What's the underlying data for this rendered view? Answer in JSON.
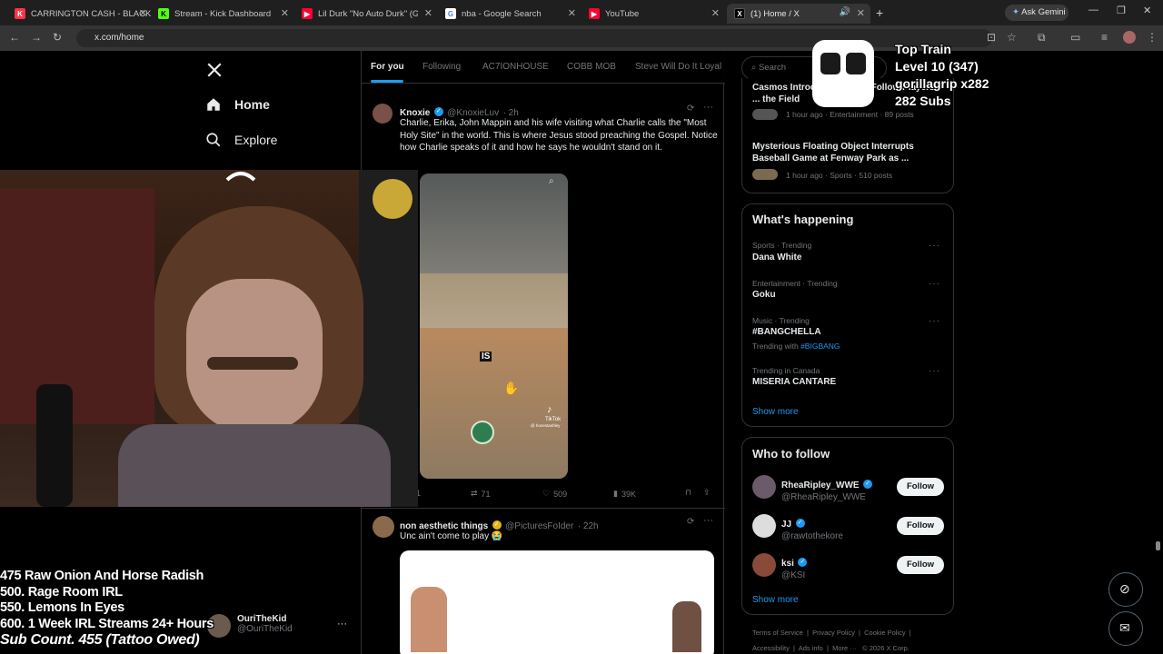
{
  "browser": {
    "tabs": [
      {
        "label": "CARRINGTON CASH - BLACK B",
        "icon": "kick-favicon",
        "color": "#ff3344"
      },
      {
        "label": "Stream - Kick Dashboard",
        "icon": "kick-favicon",
        "color": "#53fc18"
      },
      {
        "label": "Lil Durk \"No Auto Durk\" (G Her",
        "icon": "youtube-favicon",
        "color": "#ff0033"
      },
      {
        "label": "nba - Google Search",
        "icon": "google-favicon",
        "color": "#4285f4"
      },
      {
        "label": "YouTube",
        "icon": "youtube-favicon",
        "color": "#ff0033"
      },
      {
        "label": "(1) Home / X",
        "icon": "x-favicon",
        "color": "#000000"
      }
    ],
    "ask_gemini": "Ask Gemini",
    "url": "x.com/home"
  },
  "nav": {
    "home": "Home",
    "explore": "Explore"
  },
  "feed": {
    "tabs": [
      "For you",
      "Following",
      "AC7IONHOUSE",
      "COBB MOB",
      "Steve Will Do It Loyal"
    ],
    "search_placeholder": "Search",
    "post1": {
      "name": "Knoxie",
      "handle": "@KnoxieLuv",
      "time": "· 2h",
      "text": "Charlie, Erika, John Mappin and his wife visiting what Charlie calls the \"Most Holy Site\" in the world. This is where Jesus stood preaching the Gospel. Notice how Charlie speaks of it and how he says he wouldn't stand on it.",
      "video_caption": "IS",
      "tiktok": "TikTok",
      "tiktok_handle": "@ honestashley",
      "reposts": "71",
      "likes": "509",
      "views": "39K",
      "replies": "1"
    },
    "post2": {
      "name": "non aesthetic things",
      "handle": "@PicturesFoIder",
      "time": "· 22h",
      "text": "Unc ain't come to play 😭"
    },
    "suggest": {
      "name": "OuriTheKid",
      "handle": "@OuriTheKid"
    }
  },
  "right": {
    "trends_top": [
      {
        "title": "Casmos Introduces ... That Follow Players ... the Field",
        "meta": "1 hour ago · Entertainment · 89 posts"
      },
      {
        "title": "Mysterious Floating Object Interrupts Baseball Game at Fenway Park as ...",
        "meta": "1 hour ago · Sports · 510 posts"
      }
    ],
    "happening_title": "What's happening",
    "trends": [
      {
        "meta": "Sports · Trending",
        "title": "Dana White",
        "extra": ""
      },
      {
        "meta": "Entertainment · Trending",
        "title": "Goku",
        "extra": ""
      },
      {
        "meta": "Music · Trending",
        "title": "#BANGCHELLA",
        "extra_pre": "Trending with ",
        "extra": "#BIGBANG"
      },
      {
        "meta": "Trending in Canada",
        "title": "MISERIA CANTARE",
        "extra": ""
      }
    ],
    "show_more": "Show more",
    "follow_title": "Who to follow",
    "follow": [
      {
        "name": "RheaRipley_WWE",
        "handle": "@RheaRipley_WWE",
        "btn": "Follow"
      },
      {
        "name": "JJ",
        "handle": "@rawtothekore",
        "btn": "Follow"
      },
      {
        "name": "ksi",
        "handle": "@KSI",
        "btn": "Follow"
      }
    ],
    "show_more2": "Show more",
    "footer": [
      "Terms of Service",
      "|",
      "Privacy Policy",
      "|",
      "Cookie Policy",
      "|",
      "Accessibility",
      "|",
      "Ads info",
      "|",
      "More ···",
      "© 2026 X Corp."
    ]
  },
  "stream_overlay": {
    "goals": [
      "475 Raw Onion And Horse Radish",
      "500. Rage Room IRL",
      "550. Lemons In Eyes",
      "600. 1 Week IRL Streams 24+ Hours",
      "Sub Count. 455 (Tattoo Owed)"
    ],
    "top_train": {
      "title": "Top Train",
      "level": "Level 10  (347)",
      "user": "gorillagrip x282",
      "subs": "282 Subs"
    }
  }
}
